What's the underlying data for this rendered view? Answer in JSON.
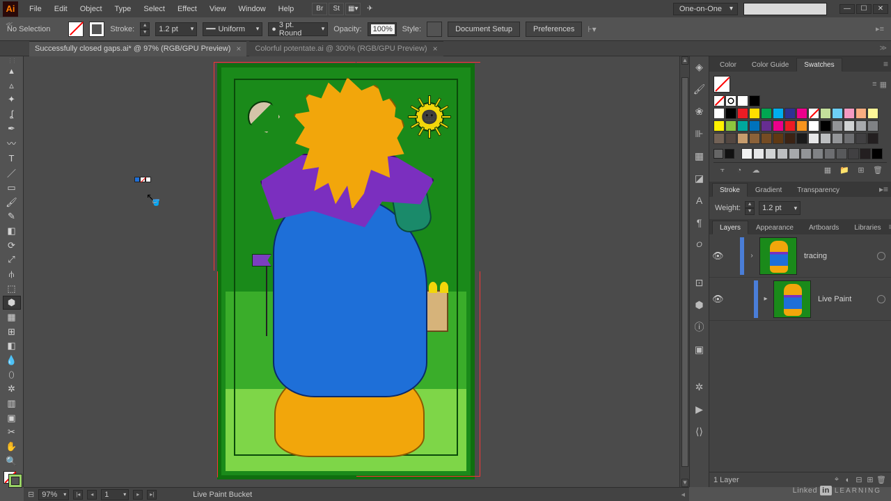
{
  "menu": {
    "items": [
      "File",
      "Edit",
      "Object",
      "Type",
      "Select",
      "Effect",
      "View",
      "Window",
      "Help"
    ],
    "workspace": "One-on-One",
    "search_placeholder": ""
  },
  "control": {
    "selection": "No Selection",
    "stroke_label": "Stroke:",
    "stroke_weight": "1.2 pt",
    "profile": "Uniform",
    "brush": "3 pt. Round",
    "opacity_label": "Opacity:",
    "opacity": "100%",
    "style_label": "Style:",
    "doc_setup": "Document Setup",
    "prefs": "Preferences"
  },
  "tabs": [
    {
      "title": "Successfully closed gaps.ai* @ 97% (RGB/GPU Preview)",
      "active": true
    },
    {
      "title": "Colorful potentate.ai @ 300% (RGB/GPU Preview)",
      "active": false
    }
  ],
  "swatches": {
    "tabs": [
      "Color",
      "Color Guide",
      "Swatches"
    ],
    "row1": [
      "#ffffff",
      "#000000",
      "#ed1c24",
      "#ffde00",
      "#00a651",
      "#00aeef",
      "#2e3192",
      "#ec008c",
      "none"
    ],
    "row2": [
      "#fff200",
      "#8dc63e",
      "#00a99d",
      "#0072bc",
      "#662d91",
      "#ec008c",
      "#ed1c24",
      "#f7941d",
      "#fff",
      "#000",
      "#939598",
      "#d1d3d4",
      "#a7a9ac",
      "#808285"
    ],
    "row3": [
      "#736357",
      "#534741",
      "#c69c6d",
      "#8c6239",
      "#754c24",
      "#603913",
      "#3b2314",
      "#1a1a1a",
      "#e6e7e8",
      "#bcbec0",
      "#939598",
      "#6d6e71",
      "#414042",
      "#231f20"
    ],
    "row4": [
      "#dcddde",
      "#bcbec0",
      "#a7a9ac",
      "#939598",
      "#7fcdee"
    ],
    "grays": [
      "#f1f2f2",
      "#e6e7e8",
      "#d1d3d4",
      "#bcbec0",
      "#a7a9ac",
      "#939598",
      "#808285",
      "#6d6e71",
      "#58595b",
      "#414042",
      "#231f20",
      "#000"
    ]
  },
  "stroke_panel": {
    "tabs": [
      "Stroke",
      "Gradient",
      "Transparency"
    ],
    "weight_label": "Weight:",
    "weight": "1.2 pt"
  },
  "layers_panel": {
    "tabs": [
      "Layers",
      "Appearance",
      "Artboards",
      "Libraries"
    ],
    "rows": [
      {
        "name": "tracing",
        "expanded": false,
        "chev": "›"
      },
      {
        "name": "Live Paint",
        "expanded": false,
        "chev": "▸"
      }
    ],
    "count": "1 Layer"
  },
  "status": {
    "zoom": "97%",
    "artboard_nav": "1",
    "tool": "Live Paint Bucket"
  },
  "footer_brand": {
    "linked": "Linked",
    "in": "in",
    "learning": "LEARNING"
  }
}
